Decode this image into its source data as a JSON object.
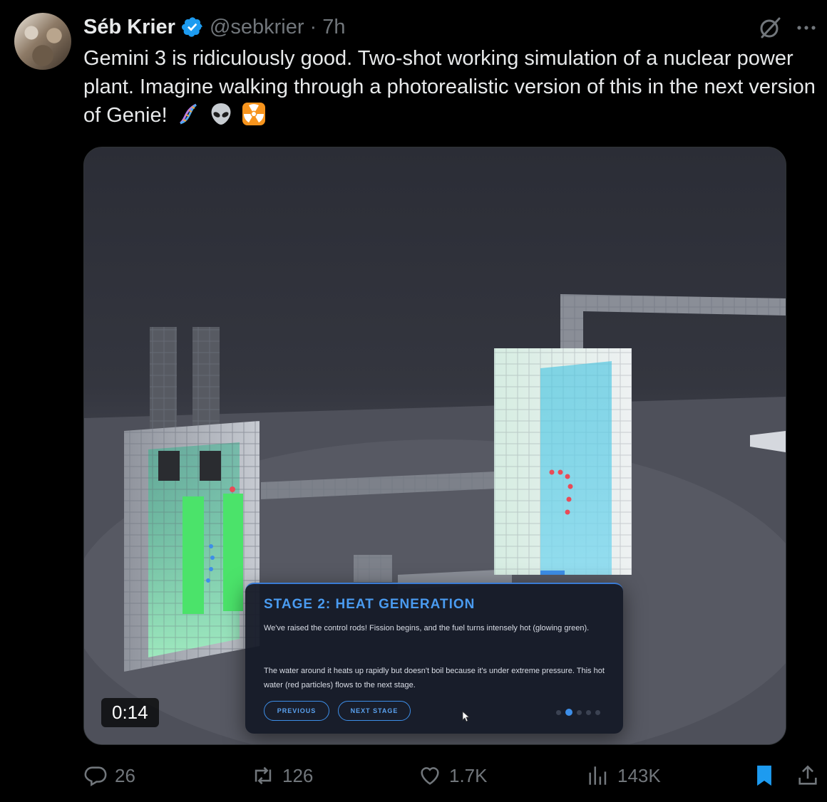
{
  "author": {
    "name": "Séb Krier",
    "handle": "@sebkrier",
    "separator": "·",
    "time": "7h"
  },
  "tweet": {
    "text": "Gemini 3 is ridiculously good. Two-shot working simulation of a nuclear power plant. Imagine walking through a photorealistic version of this in the next version of Genie!",
    "emojis": [
      "dna-emoji",
      "alien-emoji",
      "radioactive-emoji"
    ]
  },
  "media": {
    "duration": "0:14",
    "panel": {
      "title": "STAGE 2: HEAT GENERATION",
      "paragraph1": "We've raised the control rods! Fission begins, and the fuel turns intensely hot (glowing green).",
      "paragraph2": "The water around it heats up rapidly but doesn't boil because it's under extreme pressure. This hot water (red particles) flows to the next stage.",
      "previous_label": "PREVIOUS",
      "next_label": "NEXT STAGE",
      "current_page": 2,
      "total_pages": 5
    }
  },
  "actions": {
    "replies": "26",
    "reposts": "126",
    "likes": "1.7K",
    "views": "143K"
  },
  "colors": {
    "verified": "#1d9bf0",
    "muted": "#71767b",
    "bookmark": "#1d9bf0",
    "panel_accent": "#3d8ee8"
  }
}
